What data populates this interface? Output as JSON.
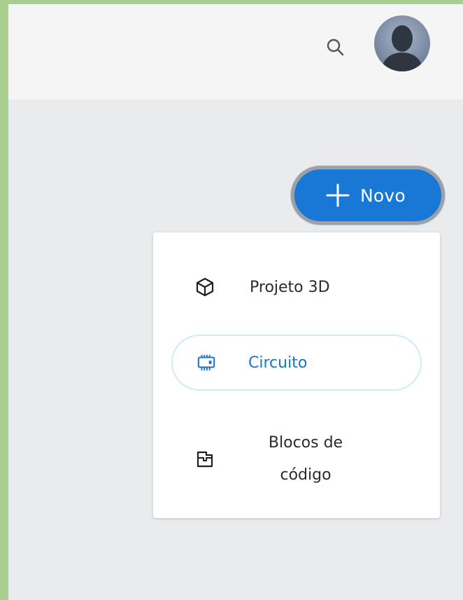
{
  "topbar": {
    "search_icon": "search-icon",
    "avatar_icon": "user-avatar"
  },
  "new_button": {
    "label": "Novo",
    "icon": "plus-icon",
    "color": "#1977d6"
  },
  "menu": {
    "items": [
      {
        "label": "Projeto 3D",
        "icon": "cube-icon"
      },
      {
        "label": "Circuito",
        "icon": "chip-icon",
        "selected": true,
        "color": "#1a73d1"
      },
      {
        "label_line1": "Blocos de",
        "label_line2": "código",
        "icon": "code-blocks-icon"
      }
    ]
  }
}
